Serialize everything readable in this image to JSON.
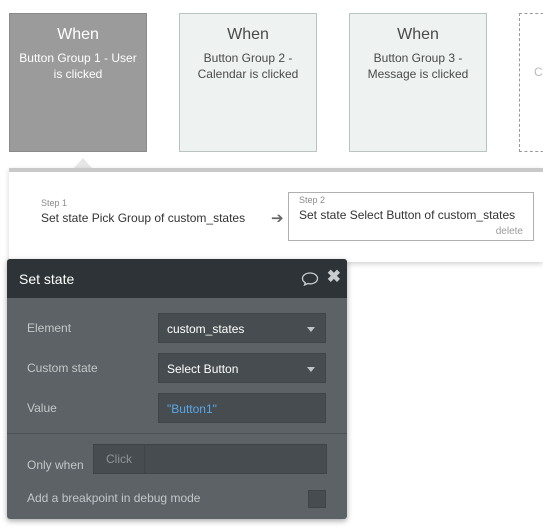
{
  "events": [
    {
      "when": "When",
      "desc": "Button Group 1 - User is clicked",
      "state": "active"
    },
    {
      "when": "When",
      "desc": "Button Group 2 - Calendar is clicked",
      "state": "inactive"
    },
    {
      "when": "When",
      "desc": "Button Group 3 - Message is clicked",
      "state": "inactive"
    },
    {
      "when": "",
      "desc": "Cl",
      "state": "ghost"
    }
  ],
  "steps": [
    {
      "num": "Step 1",
      "label": "Set state Pick Group of custom_states"
    },
    {
      "num": "Step 2",
      "label": "Set state Select Button of custom_states",
      "delete": "delete"
    }
  ],
  "panel": {
    "title": "Set state",
    "element_label": "Element",
    "element_value": "custom_states",
    "custom_state_label": "Custom state",
    "custom_state_value": "Select Button",
    "value_label": "Value",
    "value_value": "\"Button1\"",
    "only_when_label": "Only when",
    "only_when_placeholder": "Click",
    "breakpoint_label": "Add a breakpoint in debug mode"
  },
  "icons": {
    "comment": "comment-icon",
    "close": "close-icon",
    "arrow": "arrow-right-icon",
    "dropdown": "chevron-down-icon"
  },
  "colors": {
    "panel_bg": "#5c6265",
    "panel_header": "#2d3336",
    "value_text": "#5aa6e8",
    "active_card": "#9b9b9b"
  }
}
